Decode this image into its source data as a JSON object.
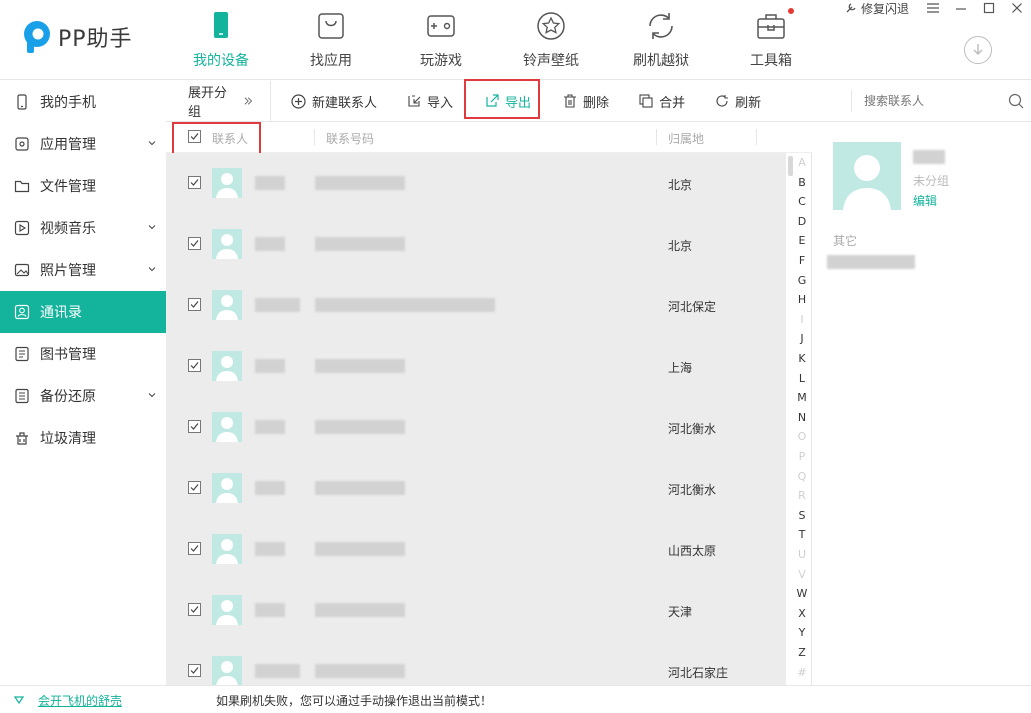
{
  "app": {
    "name": "PP助手",
    "accent": "#13b39c",
    "highlight": "#e0393e"
  },
  "window": {
    "repair_label": "修复闪退"
  },
  "nav": [
    {
      "label": "我的设备",
      "icon": "phone-icon",
      "active": true
    },
    {
      "label": "找应用",
      "icon": "bag-icon"
    },
    {
      "label": "玩游戏",
      "icon": "gamepad-icon"
    },
    {
      "label": "铃声壁纸",
      "icon": "star-icon"
    },
    {
      "label": "刷机越狱",
      "icon": "refresh-icon"
    },
    {
      "label": "工具箱",
      "icon": "toolbox-icon"
    }
  ],
  "sidebar": [
    {
      "label": "我的手机",
      "icon": "phone-icon"
    },
    {
      "label": "应用管理",
      "icon": "apps-icon",
      "expandable": true
    },
    {
      "label": "文件管理",
      "icon": "folder-icon"
    },
    {
      "label": "视频音乐",
      "icon": "play-icon",
      "expandable": true
    },
    {
      "label": "照片管理",
      "icon": "photo-icon",
      "expandable": true
    },
    {
      "label": "通讯录",
      "icon": "contacts-icon",
      "active": true
    },
    {
      "label": "图书管理",
      "icon": "book-icon"
    },
    {
      "label": "备份还原",
      "icon": "backup-icon",
      "expandable": true
    },
    {
      "label": "垃圾清理",
      "icon": "trash-clean-icon"
    }
  ],
  "toolbar": {
    "expand_label": "展开分组",
    "new_label": "新建联系人",
    "import_label": "导入",
    "export_label": "导出",
    "delete_label": "删除",
    "merge_label": "合并",
    "refresh_label": "刷新",
    "search_placeholder": "搜索联系人"
  },
  "table": {
    "headers": {
      "name": "联系人",
      "phone": "联系号码",
      "location": "归属地"
    },
    "rows": [
      {
        "location": "北京",
        "checked": true
      },
      {
        "location": "北京",
        "checked": true
      },
      {
        "location": "河北保定",
        "checked": true
      },
      {
        "location": "上海",
        "checked": true
      },
      {
        "location": "河北衡水",
        "checked": true
      },
      {
        "location": "河北衡水",
        "checked": true
      },
      {
        "location": "山西太原",
        "checked": true
      },
      {
        "location": "天津",
        "checked": true
      },
      {
        "location": "河北石家庄",
        "checked": true
      }
    ]
  },
  "alphabet": [
    "A",
    "B",
    "C",
    "D",
    "E",
    "F",
    "G",
    "H",
    "I",
    "J",
    "K",
    "L",
    "M",
    "N",
    "O",
    "P",
    "Q",
    "R",
    "S",
    "T",
    "U",
    "V",
    "W",
    "X",
    "Y",
    "Z",
    "#"
  ],
  "alphabet_dim": [
    "A",
    "I",
    "O",
    "P",
    "Q",
    "R",
    "U",
    "V",
    "#"
  ],
  "detail": {
    "group_label": "未分组",
    "edit_label": "编辑",
    "other_label": "其它"
  },
  "status": {
    "link": "会开飞机的舒売",
    "message": "如果刷机失败，您可以通过手动操作退出当前模式！"
  }
}
